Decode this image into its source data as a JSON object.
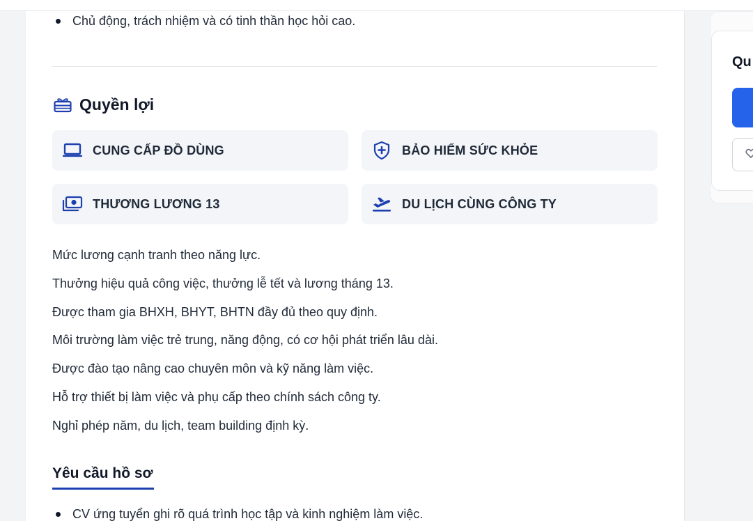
{
  "top_bullets": [
    "Chủ động, trách nhiệm và có tinh thần học hỏi cao."
  ],
  "benefits_section": {
    "title": "Quyền lợi",
    "icon": "gift-icon",
    "accent_color": "#1e40af",
    "items": [
      {
        "label": "CUNG CẤP ĐỒ DÙNG",
        "icon": "laptop-icon"
      },
      {
        "label": "BẢO HIỂM SỨC KHỎE",
        "icon": "shield-plus-icon"
      },
      {
        "label": "THƯƠNG LƯƠNG 13",
        "icon": "money-icon"
      },
      {
        "label": "DU LỊCH CÙNG CÔNG TY",
        "icon": "airplane-icon"
      }
    ],
    "paragraphs": [
      "Mức lương cạnh tranh theo năng lực.",
      "Thưởng hiệu quả công việc, thưởng lễ tết và lương tháng 13.",
      "Được tham gia BHXH, BHYT, BHTN đầy đủ theo quy định.",
      "Môi trường làm việc trẻ trung, năng động, có cơ hội phát triển lâu dài.",
      "Được đào tạo nâng cao chuyên môn và kỹ năng làm việc.",
      "Hỗ trợ thiết bị làm việc và phụ cấp theo chính sách công ty.",
      "Nghỉ phép năm, du lịch, team building định kỳ."
    ]
  },
  "requirements_section": {
    "title": "Yêu cầu hồ sơ",
    "bullets": [
      "CV ứng tuyển ghi rõ quá trình học tập và kinh nghiệm làm việc."
    ]
  },
  "sidebar": {
    "title_partial": "Qu",
    "primary_button_color": "#2563eb",
    "secondary_button_icon": "heart-icon"
  }
}
